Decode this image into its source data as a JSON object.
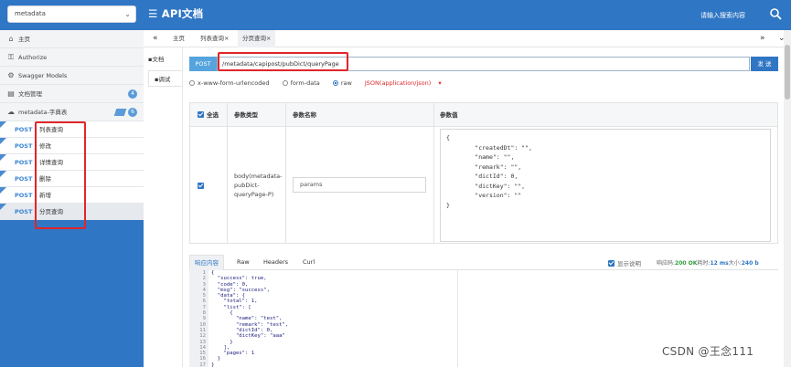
{
  "header": {
    "project_select": "metadata",
    "brand": "API文档",
    "search_label": "请输入搜索内容"
  },
  "sidebar": {
    "items": [
      {
        "label": "主页",
        "icon": "home-icon"
      },
      {
        "label": "Authorize",
        "icon": "key-icon"
      },
      {
        "label": "Swagger Models",
        "icon": "gear-icon"
      },
      {
        "label": "文档管理",
        "icon": "folder-icon",
        "badge": "4"
      },
      {
        "label": "metadata-字典表",
        "icon": "cloud-icon",
        "badge": "6"
      }
    ],
    "apis": [
      {
        "method": "POST",
        "name": "列表查询"
      },
      {
        "method": "POST",
        "name": "修改"
      },
      {
        "method": "POST",
        "name": "详情查询"
      },
      {
        "method": "POST",
        "name": "删除"
      },
      {
        "method": "POST",
        "name": "新增"
      },
      {
        "method": "POST",
        "name": "分页查询"
      }
    ]
  },
  "tabs": {
    "back": "«",
    "items": [
      "主页",
      "列表查询",
      "分页查询"
    ],
    "forward": "»",
    "menu": "⌄"
  },
  "subtabs": {
    "doc": "文档",
    "debug": "调试"
  },
  "request": {
    "method": "POST",
    "url": "/metadata/capipost/pubDict/queryPage",
    "send": "发 送",
    "content_types": [
      "x-www-form-urlencoded",
      "form-data",
      "raw"
    ],
    "raw_type": "JSON(application/json)"
  },
  "params": {
    "headers": {
      "select_all": "全选",
      "type": "参数类型",
      "name": "参数名称",
      "value": "参数值"
    },
    "row": {
      "type": "body(metadata-pubDict-queryPage-P)",
      "name": "params",
      "value": "{\n        \"createdDt\": \"\",\n        \"name\": \"\",\n        \"remark\": \"\",\n        \"dictId\": 0,\n        \"dictKey\": \"\",\n        \"version\": \"\"\n}"
    }
  },
  "response": {
    "tabs": [
      "响应内容",
      "Raw",
      "Headers",
      "Curl"
    ],
    "show_desc": "显示说明",
    "status_label": "响应码:",
    "status": "200 OK",
    "time_label": "耗时:",
    "time": "12 ms",
    "size_label": "大小:",
    "size": "240 b",
    "line_numbers": "1\n2\n3\n4\n5\n6\n7\n8\n9\n10\n11\n12\n13\n14\n15\n16\n17",
    "body": "{\n  \"success\": true,\n  \"code\": 0,\n  \"msg\": \"success\",\n  \"data\": {\n    \"total\": 1,\n    \"list\": [\n      {\n        \"name\": \"test\",\n        \"remark\": \"test\",\n        \"dictId\": 0,\n        \"dictKey\": \"aaa\"\n      }\n    ],\n    \"pages\": 1\n  }\n}"
  },
  "watermark": "CSDN @王念111"
}
